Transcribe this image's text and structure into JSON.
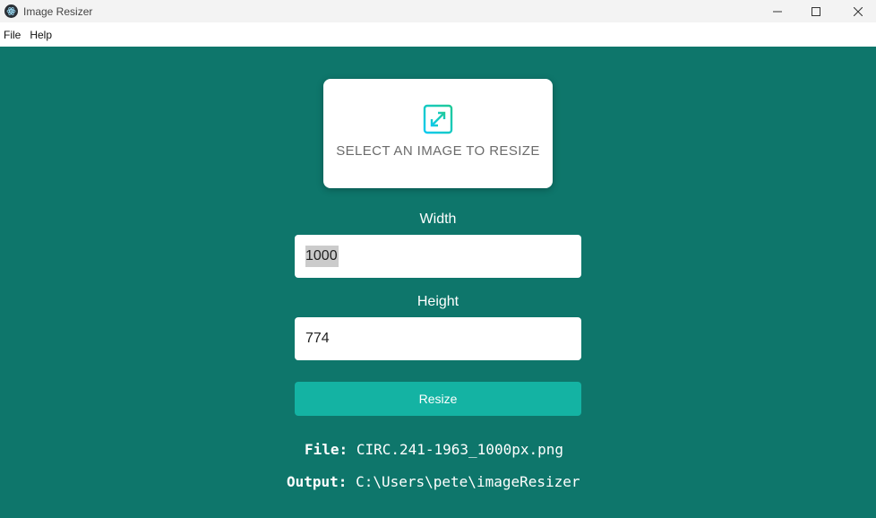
{
  "window": {
    "title": "Image Resizer"
  },
  "menu": {
    "items": [
      "File",
      "Help"
    ]
  },
  "select_card": {
    "label": "SELECT AN IMAGE TO RESIZE"
  },
  "form": {
    "width_label": "Width",
    "width_value": "1000",
    "height_label": "Height",
    "height_value": "774",
    "resize_button": "Resize"
  },
  "info": {
    "file_label": "File:",
    "file_value": "CIRC.241-1963_1000px.png",
    "output_label": "Output:",
    "output_value": "C:\\Users\\pete\\imageResizer"
  },
  "colors": {
    "background": "#0e766b",
    "button": "#14b3a3",
    "icon_gradient_start": "#20c997",
    "icon_gradient_end": "#0dcaf0"
  }
}
